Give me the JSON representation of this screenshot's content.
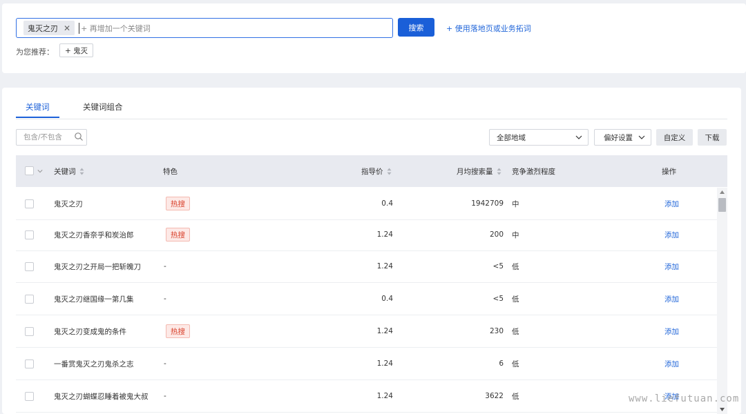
{
  "search": {
    "tag": "鬼灭之刃",
    "placeholder": "+ 再增加一个关键词",
    "button": "搜索",
    "expand_link": "+ 使用落地页或业务拓词"
  },
  "recommend": {
    "label": "为您推荐：",
    "chip": "+ 鬼灭"
  },
  "tabs": [
    {
      "label": "关键词",
      "active": true
    },
    {
      "label": "关键词组合",
      "active": false
    }
  ],
  "filters": {
    "include_placeholder": "包含/不包含",
    "region": "全部地域",
    "preference": "偏好设置",
    "custom": "自定义",
    "download": "下载"
  },
  "table": {
    "headers": {
      "keyword": "关键词",
      "feature": "特色",
      "price": "指导价",
      "volume": "月均搜索量",
      "competition": "竞争激烈程度",
      "action": "操作"
    },
    "rows": [
      {
        "keyword": "鬼灭之刃",
        "feature": "热搜",
        "price": "0.4",
        "volume": "1942709",
        "competition": "中",
        "action": "添加"
      },
      {
        "keyword": "鬼灭之刃香奈乎和炭治郎",
        "feature": "热搜",
        "price": "1.24",
        "volume": "200",
        "competition": "中",
        "action": "添加"
      },
      {
        "keyword": "鬼灭之刃之开局一把斩魄刀",
        "feature": "-",
        "price": "1.24",
        "volume": "<5",
        "competition": "低",
        "action": "添加"
      },
      {
        "keyword": "鬼灭之刃继国缘一第几集",
        "feature": "-",
        "price": "0.4",
        "volume": "<5",
        "competition": "低",
        "action": "添加"
      },
      {
        "keyword": "鬼灭之刃变成鬼的条件",
        "feature": "热搜",
        "price": "1.24",
        "volume": "230",
        "competition": "低",
        "action": "添加"
      },
      {
        "keyword": "一番赏鬼灭之刃鬼杀之志",
        "feature": "-",
        "price": "1.24",
        "volume": "6",
        "competition": "低",
        "action": "添加"
      },
      {
        "keyword": "鬼灭之刃蝴蝶忍睡着被鬼大叔",
        "feature": "-",
        "price": "1.24",
        "volume": "3622",
        "competition": "低",
        "action": "添加"
      }
    ]
  },
  "watermark": "www.liefutuan.com",
  "colors": {
    "accent": "#1a5fd8",
    "hot_badge": "#d9432e"
  }
}
